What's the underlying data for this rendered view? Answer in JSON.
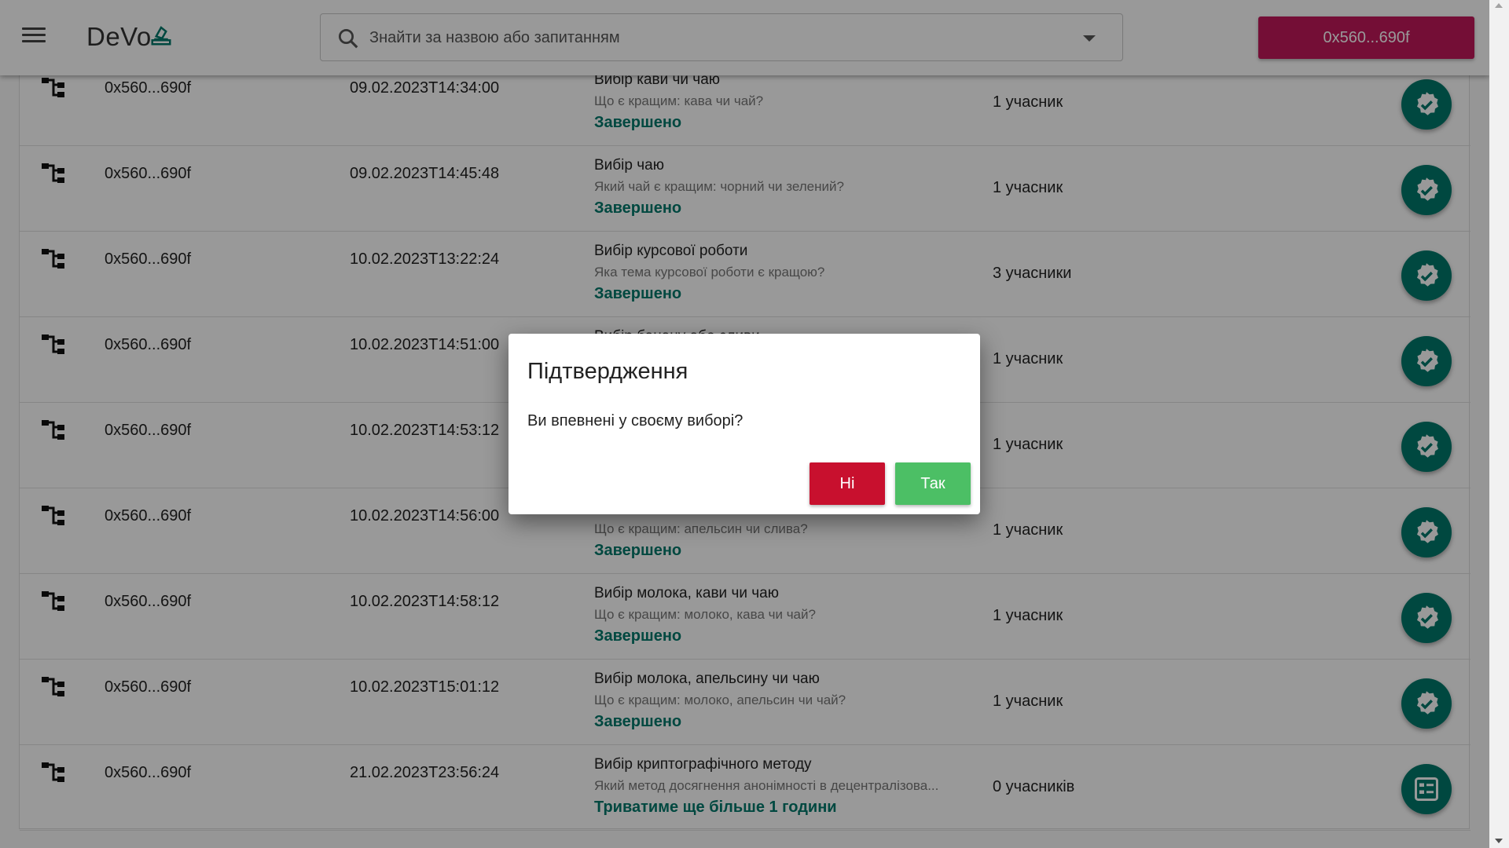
{
  "header": {
    "logo_text": "DeVo",
    "search_placeholder": "Знайти за назвою або запитанням",
    "wallet_label": "0x560...690f"
  },
  "rows": [
    {
      "address": "0x560...690f",
      "date": "09.02.2023T14:34:00",
      "title": "Вибір кави чи чаю",
      "question": "Що є кращим: кава чи чай?",
      "status": "Завершено",
      "participants": "1 учасник",
      "action_icon": "verified-icon"
    },
    {
      "address": "0x560...690f",
      "date": "09.02.2023T14:45:48",
      "title": "Вибір чаю",
      "question": "Який чай є кращим: чорний чи зелений?",
      "status": "Завершено",
      "participants": "1 учасник",
      "action_icon": "verified-icon"
    },
    {
      "address": "0x560...690f",
      "date": "10.02.2023T13:22:24",
      "title": "Вибір курсової роботи",
      "question": "Яка тема курсової роботи є кращою?",
      "status": "Завершено",
      "participants": "3 учасники",
      "action_icon": "verified-icon"
    },
    {
      "address": "0x560...690f",
      "date": "10.02.2023T14:51:00",
      "title": "Вибір банану або сливи",
      "question": "",
      "status": "",
      "participants": "1 учасник",
      "action_icon": "verified-icon"
    },
    {
      "address": "0x560...690f",
      "date": "10.02.2023T14:53:12",
      "title": "",
      "question": "",
      "status": "",
      "participants": "1 учасник",
      "action_icon": "verified-icon"
    },
    {
      "address": "0x560...690f",
      "date": "10.02.2023T14:56:00",
      "title": "",
      "question": "Що є кращим: апельсин чи слива?",
      "status": "Завершено",
      "participants": "1 учасник",
      "action_icon": "verified-icon"
    },
    {
      "address": "0x560...690f",
      "date": "10.02.2023T14:58:12",
      "title": "Вибір молока, кави чи чаю",
      "question": "Що є кращим: молоко, кава чи чай?",
      "status": "Завершено",
      "participants": "1 учасник",
      "action_icon": "verified-icon"
    },
    {
      "address": "0x560...690f",
      "date": "10.02.2023T15:01:12",
      "title": "Вибір молока, апельсину чи чаю",
      "question": "Що є кращим: молоко, апельсин чи чай?",
      "status": "Завершено",
      "participants": "1 учасник",
      "action_icon": "verified-icon"
    },
    {
      "address": "0x560...690f",
      "date": "21.02.2023T23:56:24",
      "title": "Вибір криптографічного методу",
      "question": "Який метод досягнення анонімності в децентралізова...",
      "status": "Триватиме ще більше 1 години",
      "participants": "0 учасників",
      "action_icon": "ballot-icon"
    }
  ],
  "dialog": {
    "title": "Підтвердження",
    "text": "Ви впевнені у своєму виборі?",
    "no_label": "Ні",
    "yes_label": "Так"
  },
  "colors": {
    "accent": "#00796b",
    "wallet": "#c2185b",
    "no": "#c8102e",
    "yes": "#4cbf65"
  }
}
